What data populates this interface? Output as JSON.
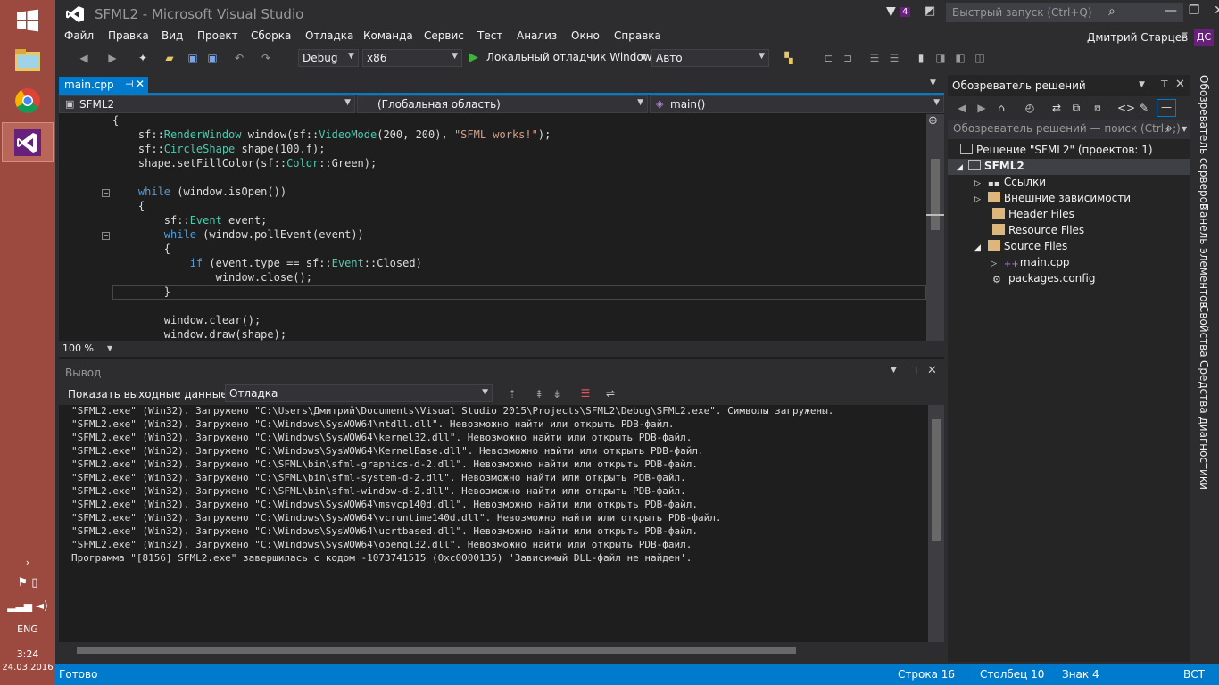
{
  "taskbar": {
    "time": "3:24",
    "date": "24.03.2016",
    "lang": "ENG"
  },
  "window": {
    "title": "SFML2 - Microsoft Visual Studio",
    "notifications": "4",
    "quick_launch_placeholder": "Быстрый запуск (Ctrl+Q)"
  },
  "menu": {
    "items": [
      "Файл",
      "Правка",
      "Вид",
      "Проект",
      "Сборка",
      "Отладка",
      "Команда",
      "Сервис",
      "Тест",
      "Анализ",
      "Окно",
      "Справка"
    ],
    "user": "Дмитрий Старцев",
    "user_initials": "ДС"
  },
  "toolbar": {
    "config": "Debug",
    "platform": "x86",
    "debugger": "Локальный отладчик Windows",
    "mode": "Авто"
  },
  "editor": {
    "tab": "main.cpp",
    "nav_project": "SFML2",
    "nav_scope": "(Глобальная область)",
    "nav_member": "main()",
    "zoom": "100 %"
  },
  "output": {
    "title": "Вывод",
    "show_label": "Показать выходные данные из:",
    "source": "Отладка",
    "lines": [
      "\"SFML2.exe\" (Win32). Загружено \"C:\\Users\\Дмитрий\\Documents\\Visual Studio 2015\\Projects\\SFML2\\Debug\\SFML2.exe\". Символы загружены.",
      "\"SFML2.exe\" (Win32). Загружено \"C:\\Windows\\SysWOW64\\ntdll.dll\". Невозможно найти или открыть PDB-файл.",
      "\"SFML2.exe\" (Win32). Загружено \"C:\\Windows\\SysWOW64\\kernel32.dll\". Невозможно найти или открыть PDB-файл.",
      "\"SFML2.exe\" (Win32). Загружено \"C:\\Windows\\SysWOW64\\KernelBase.dll\". Невозможно найти или открыть PDB-файл.",
      "\"SFML2.exe\" (Win32). Загружено \"C:\\SFML\\bin\\sfml-graphics-d-2.dll\". Невозможно найти или открыть PDB-файл.",
      "\"SFML2.exe\" (Win32). Загружено \"C:\\SFML\\bin\\sfml-system-d-2.dll\". Невозможно найти или открыть PDB-файл.",
      "\"SFML2.exe\" (Win32). Загружено \"C:\\SFML\\bin\\sfml-window-d-2.dll\". Невозможно найти или открыть PDB-файл.",
      "\"SFML2.exe\" (Win32). Загружено \"C:\\Windows\\SysWOW64\\msvcp140d.dll\". Невозможно найти или открыть PDB-файл.",
      "\"SFML2.exe\" (Win32). Загружено \"C:\\Windows\\SysWOW64\\vcruntime140d.dll\". Невозможно найти или открыть PDB-файл.",
      "\"SFML2.exe\" (Win32). Загружено \"C:\\Windows\\SysWOW64\\ucrtbased.dll\". Невозможно найти или открыть PDB-файл.",
      "\"SFML2.exe\" (Win32). Загружено \"C:\\Windows\\SysWOW64\\opengl32.dll\". Невозможно найти или открыть PDB-файл.",
      "Программа \"[8156] SFML2.exe\" завершилась с кодом -1073741515 (0xc0000135) 'Зависимый DLL-файл не найден'."
    ]
  },
  "solution": {
    "title": "Обозреватель решений",
    "search_placeholder": "Обозреватель решений — поиск (Ctrl+;)",
    "solution_label": "Решение \"SFML2\" (проектов: 1)",
    "project": "SFML2",
    "items": [
      "Ссылки",
      "Внешние зависимости",
      "Header Files",
      "Resource Files",
      "Source Files",
      "main.cpp",
      "packages.config"
    ]
  },
  "side_tabs": [
    "Обозреватель серверов",
    "Панель элементов",
    "Свойства",
    "Средства диагностики"
  ],
  "status": {
    "ready": "Готово",
    "line": "Строка 16",
    "col": "Столбец 10",
    "char": "Знак 4",
    "mode": "ВСТ"
  },
  "colors": {
    "accent": "#007acc",
    "vs_purple": "#68217a",
    "taskbar": "#9c4a3f"
  }
}
